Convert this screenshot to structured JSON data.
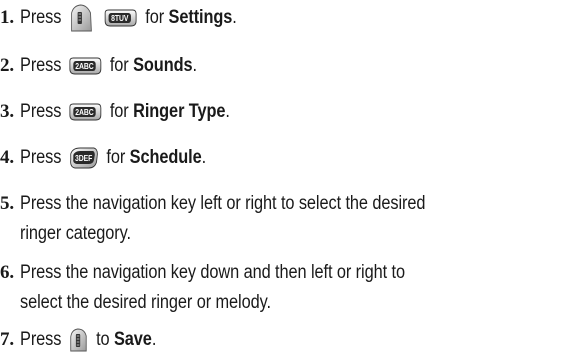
{
  "steps": [
    {
      "number": "1.",
      "press": "Press",
      "key1": "menu-key",
      "key2_label": "8TUV",
      "for": "for",
      "target": "Settings",
      "end": "."
    },
    {
      "number": "2.",
      "press": "Press",
      "key_label": "2ABC",
      "for": "for",
      "target": "Sounds",
      "end": "."
    },
    {
      "number": "3.",
      "press": "Press",
      "key_label": "2ABC",
      "for": "for",
      "target": "Ringer Type",
      "end": "."
    },
    {
      "number": "4.",
      "press": "Press",
      "key_label": "3DEF",
      "for": "for",
      "target": "Schedule",
      "end": "."
    },
    {
      "number": "5.",
      "line1": "Press the navigation key left or right to select the desired",
      "line2": "ringer category."
    },
    {
      "number": "6.",
      "line1": "Press the navigation key down and then left or right to",
      "line2": "select the desired ringer or melody."
    },
    {
      "number": "7.",
      "press": "Press",
      "key": "menu-ok-key",
      "to": "to",
      "target": "Save",
      "end": "."
    }
  ]
}
